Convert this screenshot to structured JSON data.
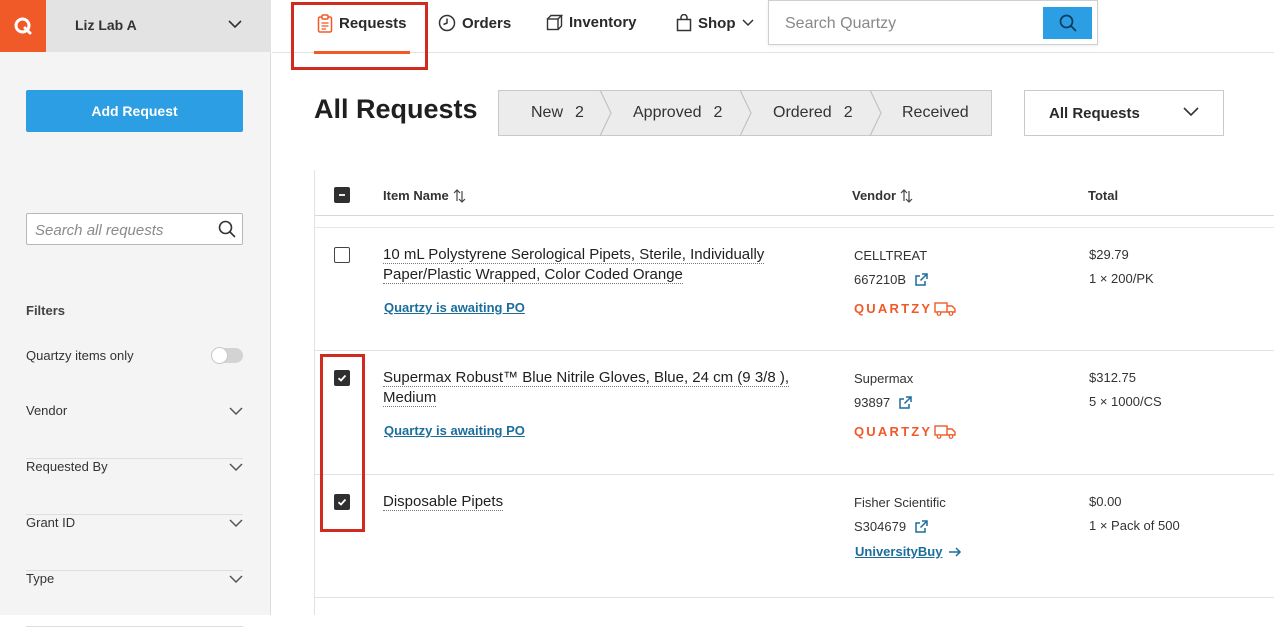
{
  "sidebar": {
    "lab_name": "Liz Lab A",
    "add_request_label": "Add Request",
    "search_placeholder": "Search all requests",
    "filters_title": "Filters",
    "quartzy_only_label": "Quartzy items only",
    "filters": [
      "Vendor",
      "Requested By",
      "Grant ID",
      "Type"
    ]
  },
  "nav": {
    "requests": "Requests",
    "orders": "Orders",
    "inventory": "Inventory",
    "shop": "Shop",
    "search_placeholder": "Search Quartzy"
  },
  "main": {
    "title": "All Requests",
    "steps": [
      {
        "label": "New",
        "count": "2"
      },
      {
        "label": "Approved",
        "count": "2"
      },
      {
        "label": "Ordered",
        "count": "2"
      },
      {
        "label": "Received",
        "count": ""
      }
    ],
    "filter_dropdown": "All Requests"
  },
  "table": {
    "columns": {
      "item": "Item Name",
      "vendor": "Vendor",
      "total": "Total"
    },
    "rows": [
      {
        "name_line1": "10 mL Polystyrene Serological Pipets, Sterile, Individually",
        "name_line2": "Paper/Plastic Wrapped, Color Coded Orange",
        "status": "Quartzy is awaiting PO",
        "vendor": "CELLTREAT",
        "catalog": "667210B",
        "brand": "QUARTZY",
        "total": "$29.79",
        "qty": "1 × 200/PK",
        "checked": false
      },
      {
        "name_line1": "Supermax Robust™ Blue Nitrile Gloves, Blue, 24 cm (9 3/8 ),",
        "name_line2": "Medium",
        "status": "Quartzy is awaiting PO",
        "vendor": "Supermax",
        "catalog": "93897",
        "brand": "QUARTZY",
        "total": "$312.75",
        "qty": "5 × 1000/CS",
        "checked": true
      },
      {
        "name_line1": "Disposable Pipets",
        "name_line2": "",
        "status": "",
        "vendor": "Fisher Scientific",
        "catalog": "S304679",
        "link": "UniversityBuy",
        "total": "$0.00",
        "qty": "1 × Pack of 500",
        "checked": true
      }
    ]
  },
  "colors": {
    "brand_orange": "#f05a28",
    "primary_blue": "#2b9ee4",
    "highlight_red": "#d12a1f"
  }
}
